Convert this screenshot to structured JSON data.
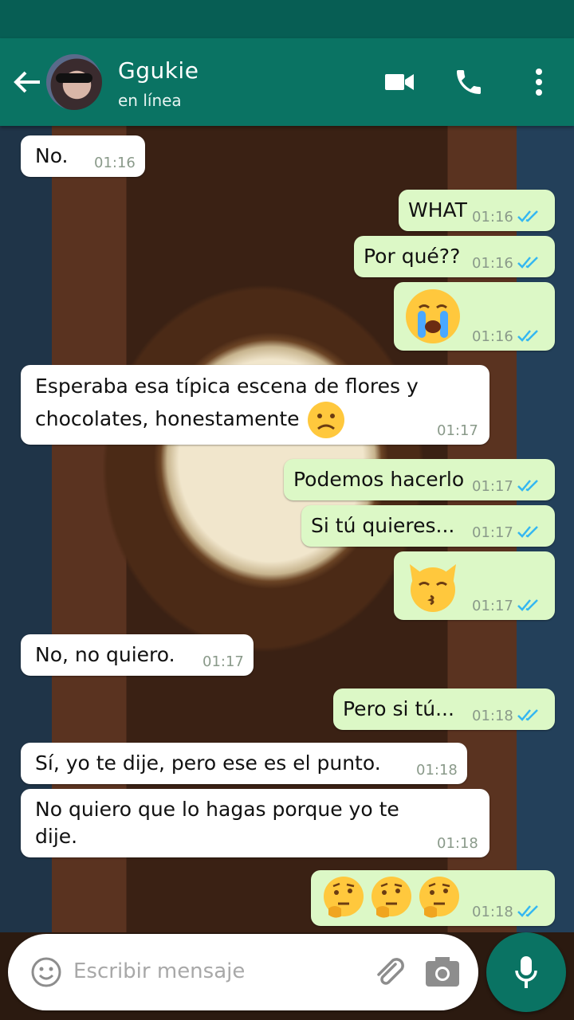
{
  "header": {
    "contact_name": "Ggukie",
    "status": "en línea",
    "icons": [
      "back-arrow-icon",
      "video-call-icon",
      "phone-icon",
      "more-vert-icon"
    ],
    "color": "#0a7363"
  },
  "messages": [
    {
      "dir": "in",
      "text": "No.",
      "time": "01:16"
    },
    {
      "dir": "out",
      "text": "WHAT",
      "time": "01:16",
      "read": true
    },
    {
      "dir": "out",
      "text": "Por qué??",
      "time": "01:16",
      "read": true
    },
    {
      "dir": "out",
      "emoji": "crying-face",
      "time": "01:16",
      "read": true
    },
    {
      "dir": "in",
      "text_lines": [
        "Esperaba esa típica escena de flores y",
        "chocolates, honestamente"
      ],
      "emoji": "slightly-frowning-face",
      "time": "01:17"
    },
    {
      "dir": "out",
      "text": "Podemos hacerlo",
      "time": "01:17",
      "read": true
    },
    {
      "dir": "out",
      "text": "Si tú quieres...",
      "time": "01:17",
      "read": true
    },
    {
      "dir": "out",
      "emoji": "kissing-cat",
      "time": "01:17",
      "read": true
    },
    {
      "dir": "in",
      "text": "No, no quiero.",
      "time": "01:17"
    },
    {
      "dir": "out",
      "text": "Pero si tú...",
      "time": "01:18",
      "read": true
    },
    {
      "dir": "in",
      "text": "Sí, yo te dije, pero ese es el punto.",
      "time": "01:18"
    },
    {
      "dir": "in",
      "text_lines": [
        "No quiero que lo hagas porque yo te",
        "dije."
      ],
      "time": "01:18"
    },
    {
      "dir": "out",
      "emoji": "thinking-face x3",
      "time": "01:18",
      "read": true
    }
  ],
  "input": {
    "placeholder": "Escribir mensaje",
    "icons": [
      "emoji-icon",
      "attach-icon",
      "camera-icon",
      "mic-icon"
    ]
  }
}
